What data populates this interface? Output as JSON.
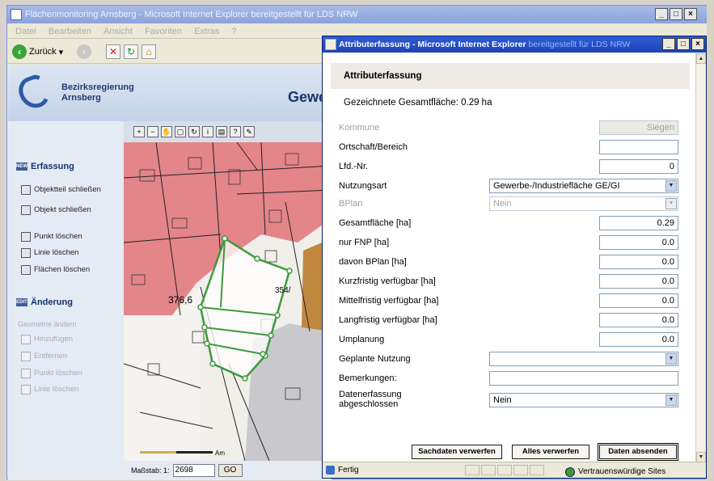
{
  "background_window": {
    "title": "Flächenmonitoring Arnsberg - Microsoft Internet Explorer bereitgestellt für LDS NRW",
    "menu": [
      "Datei",
      "Bearbeiten",
      "Ansicht",
      "Favoriten",
      "Extras",
      "?"
    ],
    "toolbar": {
      "back_label": "Zurück"
    },
    "header": {
      "org_line1": "Bezirksregierung",
      "org_line2": "Arnsberg",
      "page_word": "Gewe"
    },
    "nav": {
      "erfassung_title": "Erfassung",
      "erfassung_items": [
        "Objektteil schließen",
        "Objekt schließen",
        "Punkt löschen",
        "Linie löschen",
        "Flächen löschen"
      ],
      "aenderung_title": "Änderung",
      "aenderung_subtitle": "Geometrie ändern",
      "aenderung_items": [
        "Hinzufügen",
        "Entfernen",
        "Punkt löschen",
        "Linie löschen"
      ]
    },
    "map": {
      "annotation_a": "376,6",
      "annotation_b": "354/",
      "scale_tail": "Am",
      "scale_label": "Maßstab: 1:",
      "scale_value": "2698",
      "go_label": "GO"
    }
  },
  "dialog": {
    "title_main": "Attributerfassung - Microsoft Internet Explorer",
    "title_tail": "bereitgestellt für LDS NRW",
    "heading": "Attributerfassung",
    "gesamt": "Gezeichnete Gesamtfläche: 0.29 ha",
    "fields": {
      "kommune": {
        "label": "Kommune",
        "value": "Siegen"
      },
      "ortschaft": {
        "label": "Ortschaft/Bereich",
        "value": ""
      },
      "lfd_nr": {
        "label": "Lfd.-Nr.",
        "value": "0"
      },
      "nutzungsart": {
        "label": "Nutzungsart",
        "value": "Gewerbe-/Industriefläche GE/GI"
      },
      "bplan": {
        "label": "BPlan",
        "value": "Nein"
      },
      "gesamtflaeche": {
        "label": "Gesamtfläche [ha]",
        "value": "0.29"
      },
      "nur_fnp": {
        "label": "nur FNP [ha]",
        "value": "0.0"
      },
      "davon_bplan": {
        "label": "davon BPlan [ha]",
        "value": "0.0"
      },
      "kurzfristig": {
        "label": "Kurzfristig verfügbar [ha]",
        "value": "0.0"
      },
      "mittelfristig": {
        "label": "Mittelfristig verfügbar [ha]",
        "value": "0.0"
      },
      "langfristig": {
        "label": "Langfristig verfügbar [ha]",
        "value": "0.0"
      },
      "umplanung": {
        "label": "Umplanung",
        "value": "0.0"
      },
      "geplante_nutzung": {
        "label": "Geplante Nutzung",
        "value": ""
      },
      "bemerkungen": {
        "label": "Bemerkungen:",
        "value": ""
      },
      "abgeschlossen": {
        "label_line1": "Datenerfassung",
        "label_line2": "abgeschlossen",
        "value": "Nein"
      }
    },
    "buttons": {
      "sachdaten": "Sachdaten verwerfen",
      "alles": "Alles verwerfen",
      "absenden": "Daten absenden"
    },
    "status": {
      "left": "Fertig",
      "zone": "Vertrauenswürdige Sites"
    }
  },
  "colors": {
    "map_red": "#e4858a",
    "parcel_green": "#3c9a3c",
    "dialog_title": "#2450c8"
  }
}
